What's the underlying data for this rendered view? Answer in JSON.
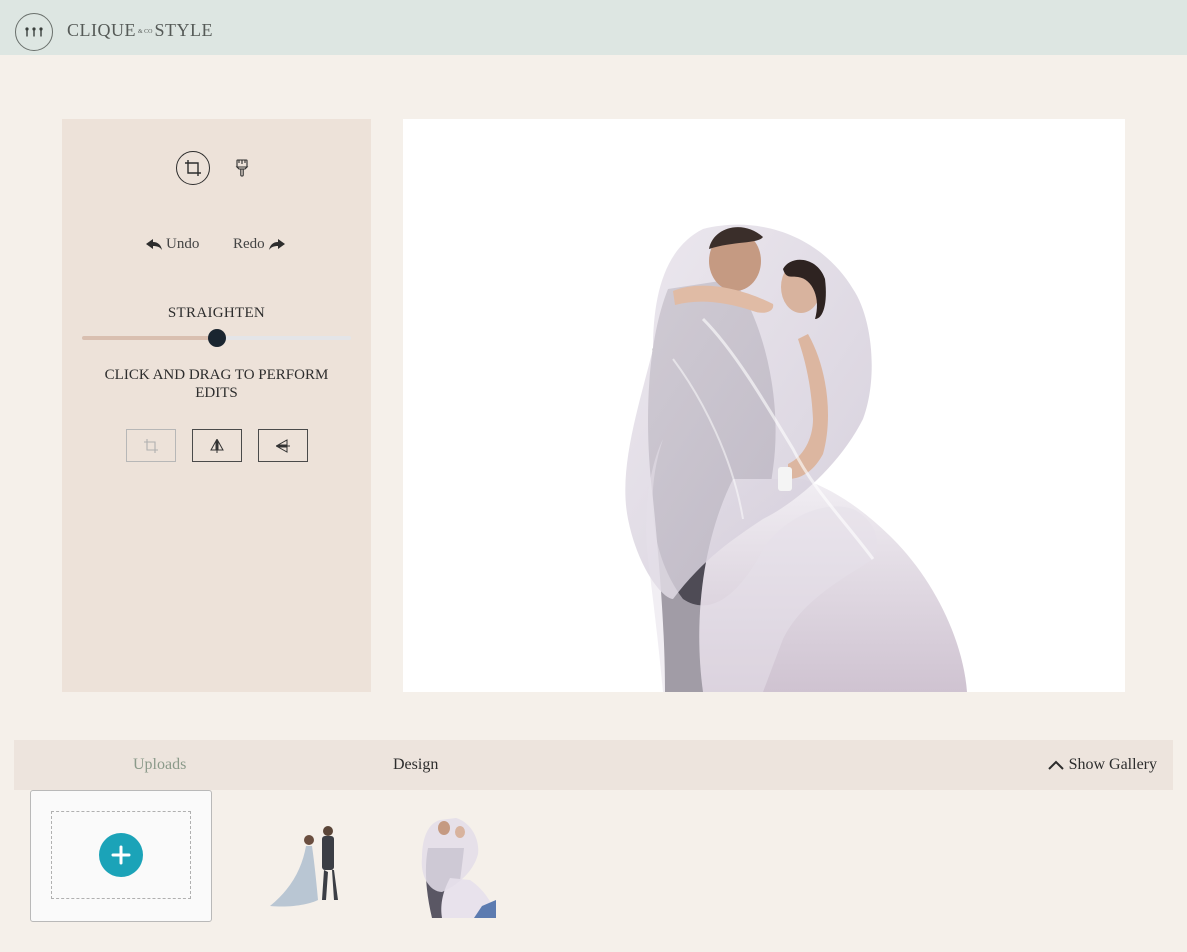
{
  "brand": {
    "logo_glyph": "⫶⫶⫶",
    "name_left": "CLIQUE",
    "name_joiner": "& CO",
    "name_right": "STYLE"
  },
  "editor": {
    "undo_label": "Undo",
    "redo_label": "Redo",
    "straighten_label": "STRAIGHTEN",
    "straighten_value": 0.5,
    "instructions": "CLICK AND DRAG TO PERFORM EDITS"
  },
  "tabs": {
    "uploads": "Uploads",
    "design": "Design",
    "show_gallery": "Show Gallery"
  },
  "colors": {
    "header_bg": "#dde6e2",
    "page_bg": "#f5f0ea",
    "panel_bg": "#ede2d9",
    "accent": "#1ba3b8",
    "slider_thumb": "#1a2530"
  }
}
